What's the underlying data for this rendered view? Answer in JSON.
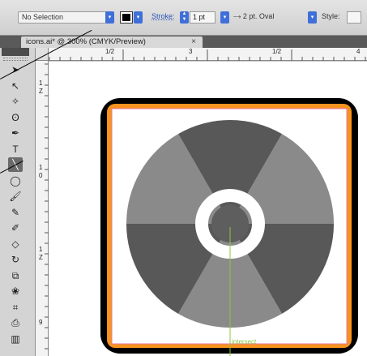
{
  "control_bar": {
    "selection_text": "No Selection",
    "stroke_label": "Stroke:",
    "stroke_weight": "1 pt",
    "profile_text": "2 pt. Oval",
    "style_label": "Style:",
    "dropdown_glyph": "▾"
  },
  "tab": {
    "title": "icons.ai* @ 300% (CMYK/Preview)",
    "close_glyph": "×"
  },
  "rulers": {
    "horizontal_labels": [
      "1/2",
      "3",
      "1/2",
      "4"
    ],
    "vertical_labels": [
      "1",
      "Z",
      "1",
      "0",
      "1",
      "Z",
      "9"
    ]
  },
  "tools": [
    {
      "name": "selection-tool-icon",
      "glyph": "➤"
    },
    {
      "name": "direct-selection-tool-icon",
      "glyph": "↖"
    },
    {
      "name": "magic-wand-tool-icon",
      "glyph": "✧"
    },
    {
      "name": "lasso-tool-icon",
      "glyph": "ʘ"
    },
    {
      "name": "pen-tool-icon",
      "glyph": "✒"
    },
    {
      "name": "type-tool-icon",
      "glyph": "T"
    },
    {
      "name": "line-segment-tool-icon",
      "glyph": "╲"
    },
    {
      "name": "ellipse-tool-icon",
      "glyph": "◯"
    },
    {
      "name": "paintbrush-tool-icon",
      "glyph": "🖌"
    },
    {
      "name": "pencil-tool-icon",
      "glyph": "✎"
    },
    {
      "name": "blob-brush-tool-icon",
      "glyph": "✐"
    },
    {
      "name": "eraser-tool-icon",
      "glyph": "◇"
    },
    {
      "name": "rotate-tool-icon",
      "glyph": "↻"
    },
    {
      "name": "scale-tool-icon",
      "glyph": "⧉"
    },
    {
      "name": "warp-tool-icon",
      "glyph": "❀"
    },
    {
      "name": "free-transform-tool-icon",
      "glyph": "⌗"
    },
    {
      "name": "symbol-sprayer-tool-icon",
      "glyph": "⎙"
    },
    {
      "name": "column-graph-tool-icon",
      "glyph": "▥"
    }
  ],
  "canvas": {
    "smart_guide_label": "intersect",
    "colors": {
      "frame": "#000000",
      "orange": "#f7931e",
      "artboard_border": "#e47aa0",
      "wheel_light": "#8a8a8a",
      "wheel_dark": "#585858",
      "wheel_center": "#5e5e5e",
      "ring": "#ffffff",
      "guide": "#8cc63f"
    }
  }
}
